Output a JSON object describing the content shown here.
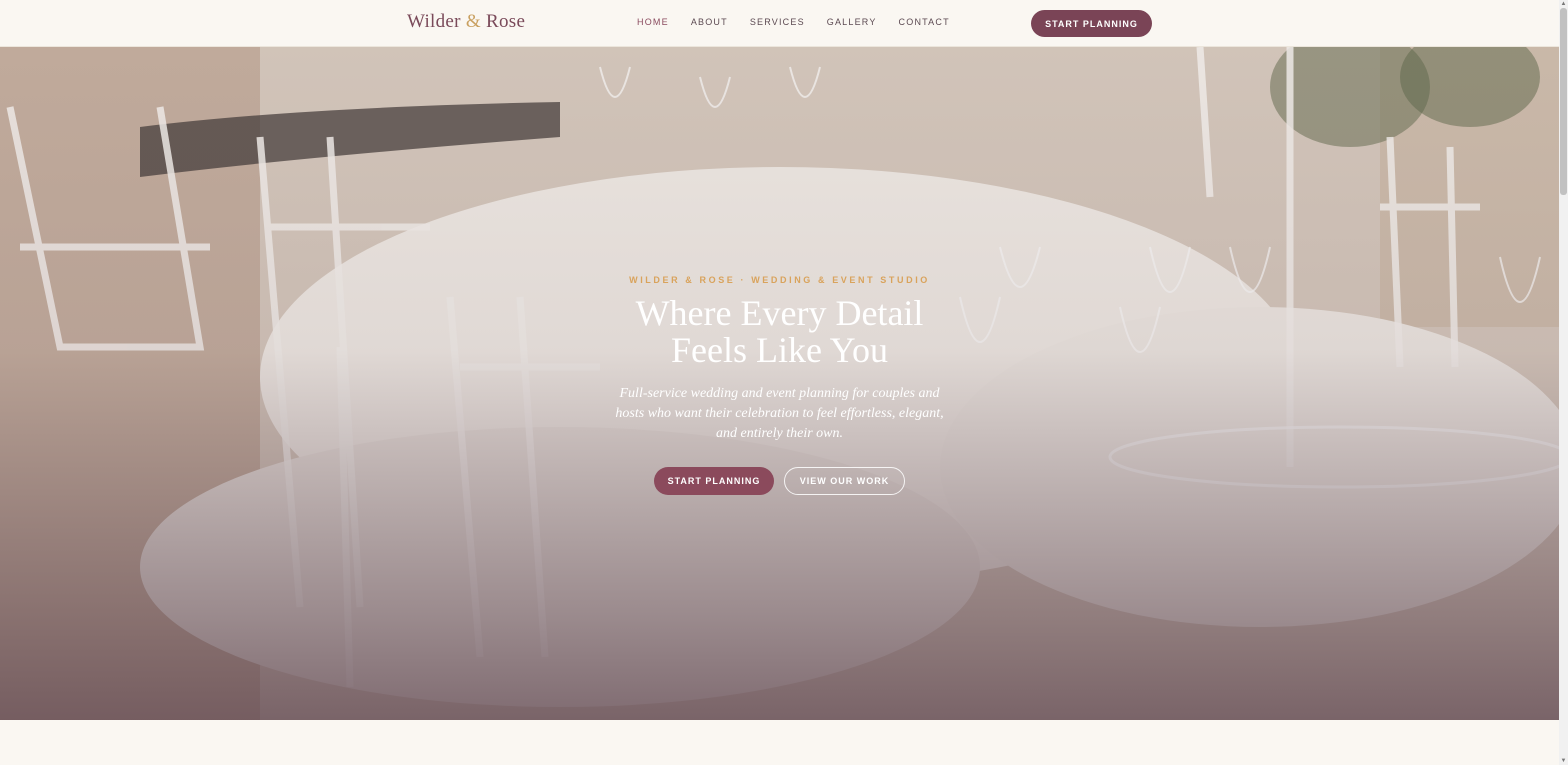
{
  "header": {
    "logo": {
      "part1": "Wilder",
      "amp": "&",
      "part2": "Rose"
    },
    "nav": [
      {
        "label": "HOME",
        "active": true
      },
      {
        "label": "ABOUT",
        "active": false
      },
      {
        "label": "SERVICES",
        "active": false
      },
      {
        "label": "GALLERY",
        "active": false
      },
      {
        "label": "CONTACT",
        "active": false
      }
    ],
    "cta_label": "START PLANNING"
  },
  "hero": {
    "eyebrow": "WILDER & ROSE · WEDDING & EVENT STUDIO",
    "headline_line1": "Where Every Detail",
    "headline_line2": "Feels Like You",
    "subtext": "Full-service wedding and event planning for couples and hosts who want their celebration to feel effortless, elegant, and entirely their own.",
    "primary_button": "START PLANNING",
    "secondary_button": "VIEW OUR WORK",
    "background_image": "outdoor-table-setting-photo"
  },
  "colors": {
    "brand_plum": "#7a4456",
    "accent_gold": "#c9a060",
    "page_bg": "#faf7f2"
  }
}
